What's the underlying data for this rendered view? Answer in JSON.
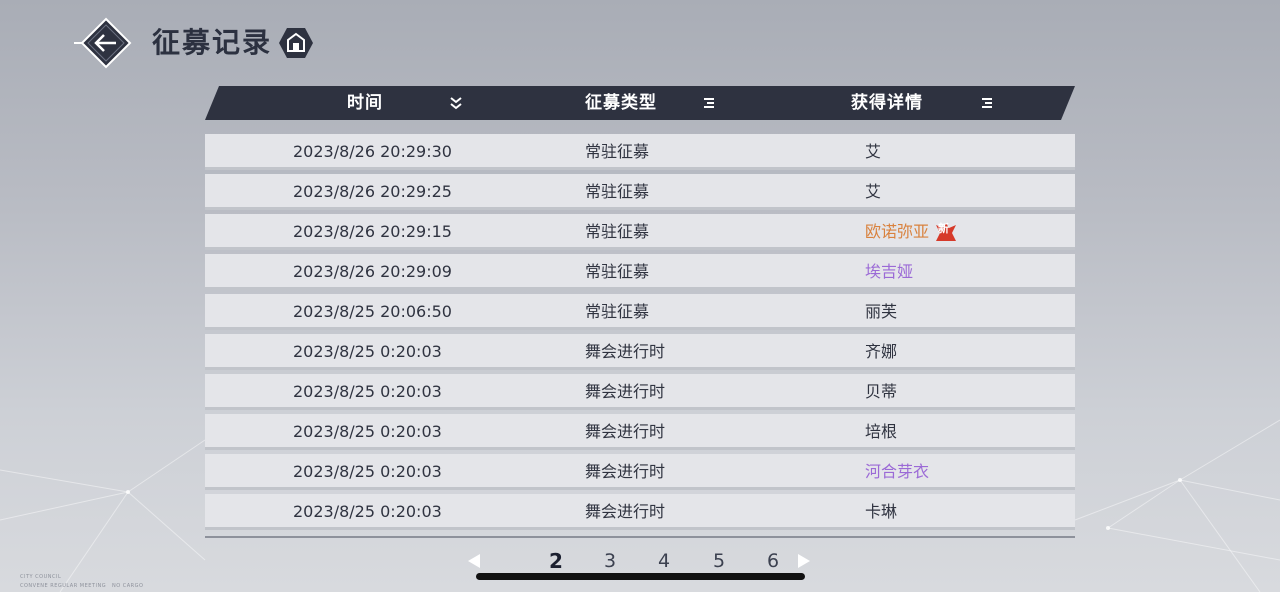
{
  "header": {
    "title": "征募记录",
    "back_icon": "back-arrow-icon",
    "home_icon": "home-icon"
  },
  "table": {
    "columns": [
      {
        "label": "时间",
        "icon": "sort-descending-icon"
      },
      {
        "label": "征募类型",
        "icon": "filter-icon"
      },
      {
        "label": "获得详情",
        "icon": "filter-icon"
      }
    ],
    "rows": [
      {
        "time": "2023/8/26 20:29:30",
        "type": "常驻征募",
        "detail": "艾",
        "color": "#2f3340"
      },
      {
        "time": "2023/8/26 20:29:25",
        "type": "常驻征募",
        "detail": "艾",
        "color": "#2f3340"
      },
      {
        "time": "2023/8/26 20:29:15",
        "type": "常驻征募",
        "detail": "欧诺弥亚",
        "color": "#d9823e",
        "badge": "新"
      },
      {
        "time": "2023/8/26 20:29:09",
        "type": "常驻征募",
        "detail": "埃吉娅",
        "color": "#9b6ad6"
      },
      {
        "time": "2023/8/25 20:06:50",
        "type": "常驻征募",
        "detail": "丽芙",
        "color": "#2f3340"
      },
      {
        "time": "2023/8/25 0:20:03",
        "type": "舞会进行时",
        "detail": "齐娜",
        "color": "#2f3340"
      },
      {
        "time": "2023/8/25 0:20:03",
        "type": "舞会进行时",
        "detail": "贝蒂",
        "color": "#2f3340"
      },
      {
        "time": "2023/8/25 0:20:03",
        "type": "舞会进行时",
        "detail": "培根",
        "color": "#2f3340"
      },
      {
        "time": "2023/8/25 0:20:03",
        "type": "舞会进行时",
        "detail": "河合芽衣",
        "color": "#9b6ad6"
      },
      {
        "time": "2023/8/25 0:20:03",
        "type": "舞会进行时",
        "detail": "卡琳",
        "color": "#2f3340"
      }
    ]
  },
  "pagination": {
    "pages": [
      "2",
      "3",
      "4",
      "5",
      "6"
    ],
    "current": "2"
  },
  "corner_text": {
    "line1": "CITY COUNCIL",
    "line2": "CONVENE REGULAR MEETING",
    "line3": "NO CARGO"
  },
  "colors": {
    "header_bar": "#2e3240",
    "row_bg": "#e4e5e9",
    "rarity_orange": "#d9823e",
    "rarity_purple": "#9b6ad6"
  }
}
